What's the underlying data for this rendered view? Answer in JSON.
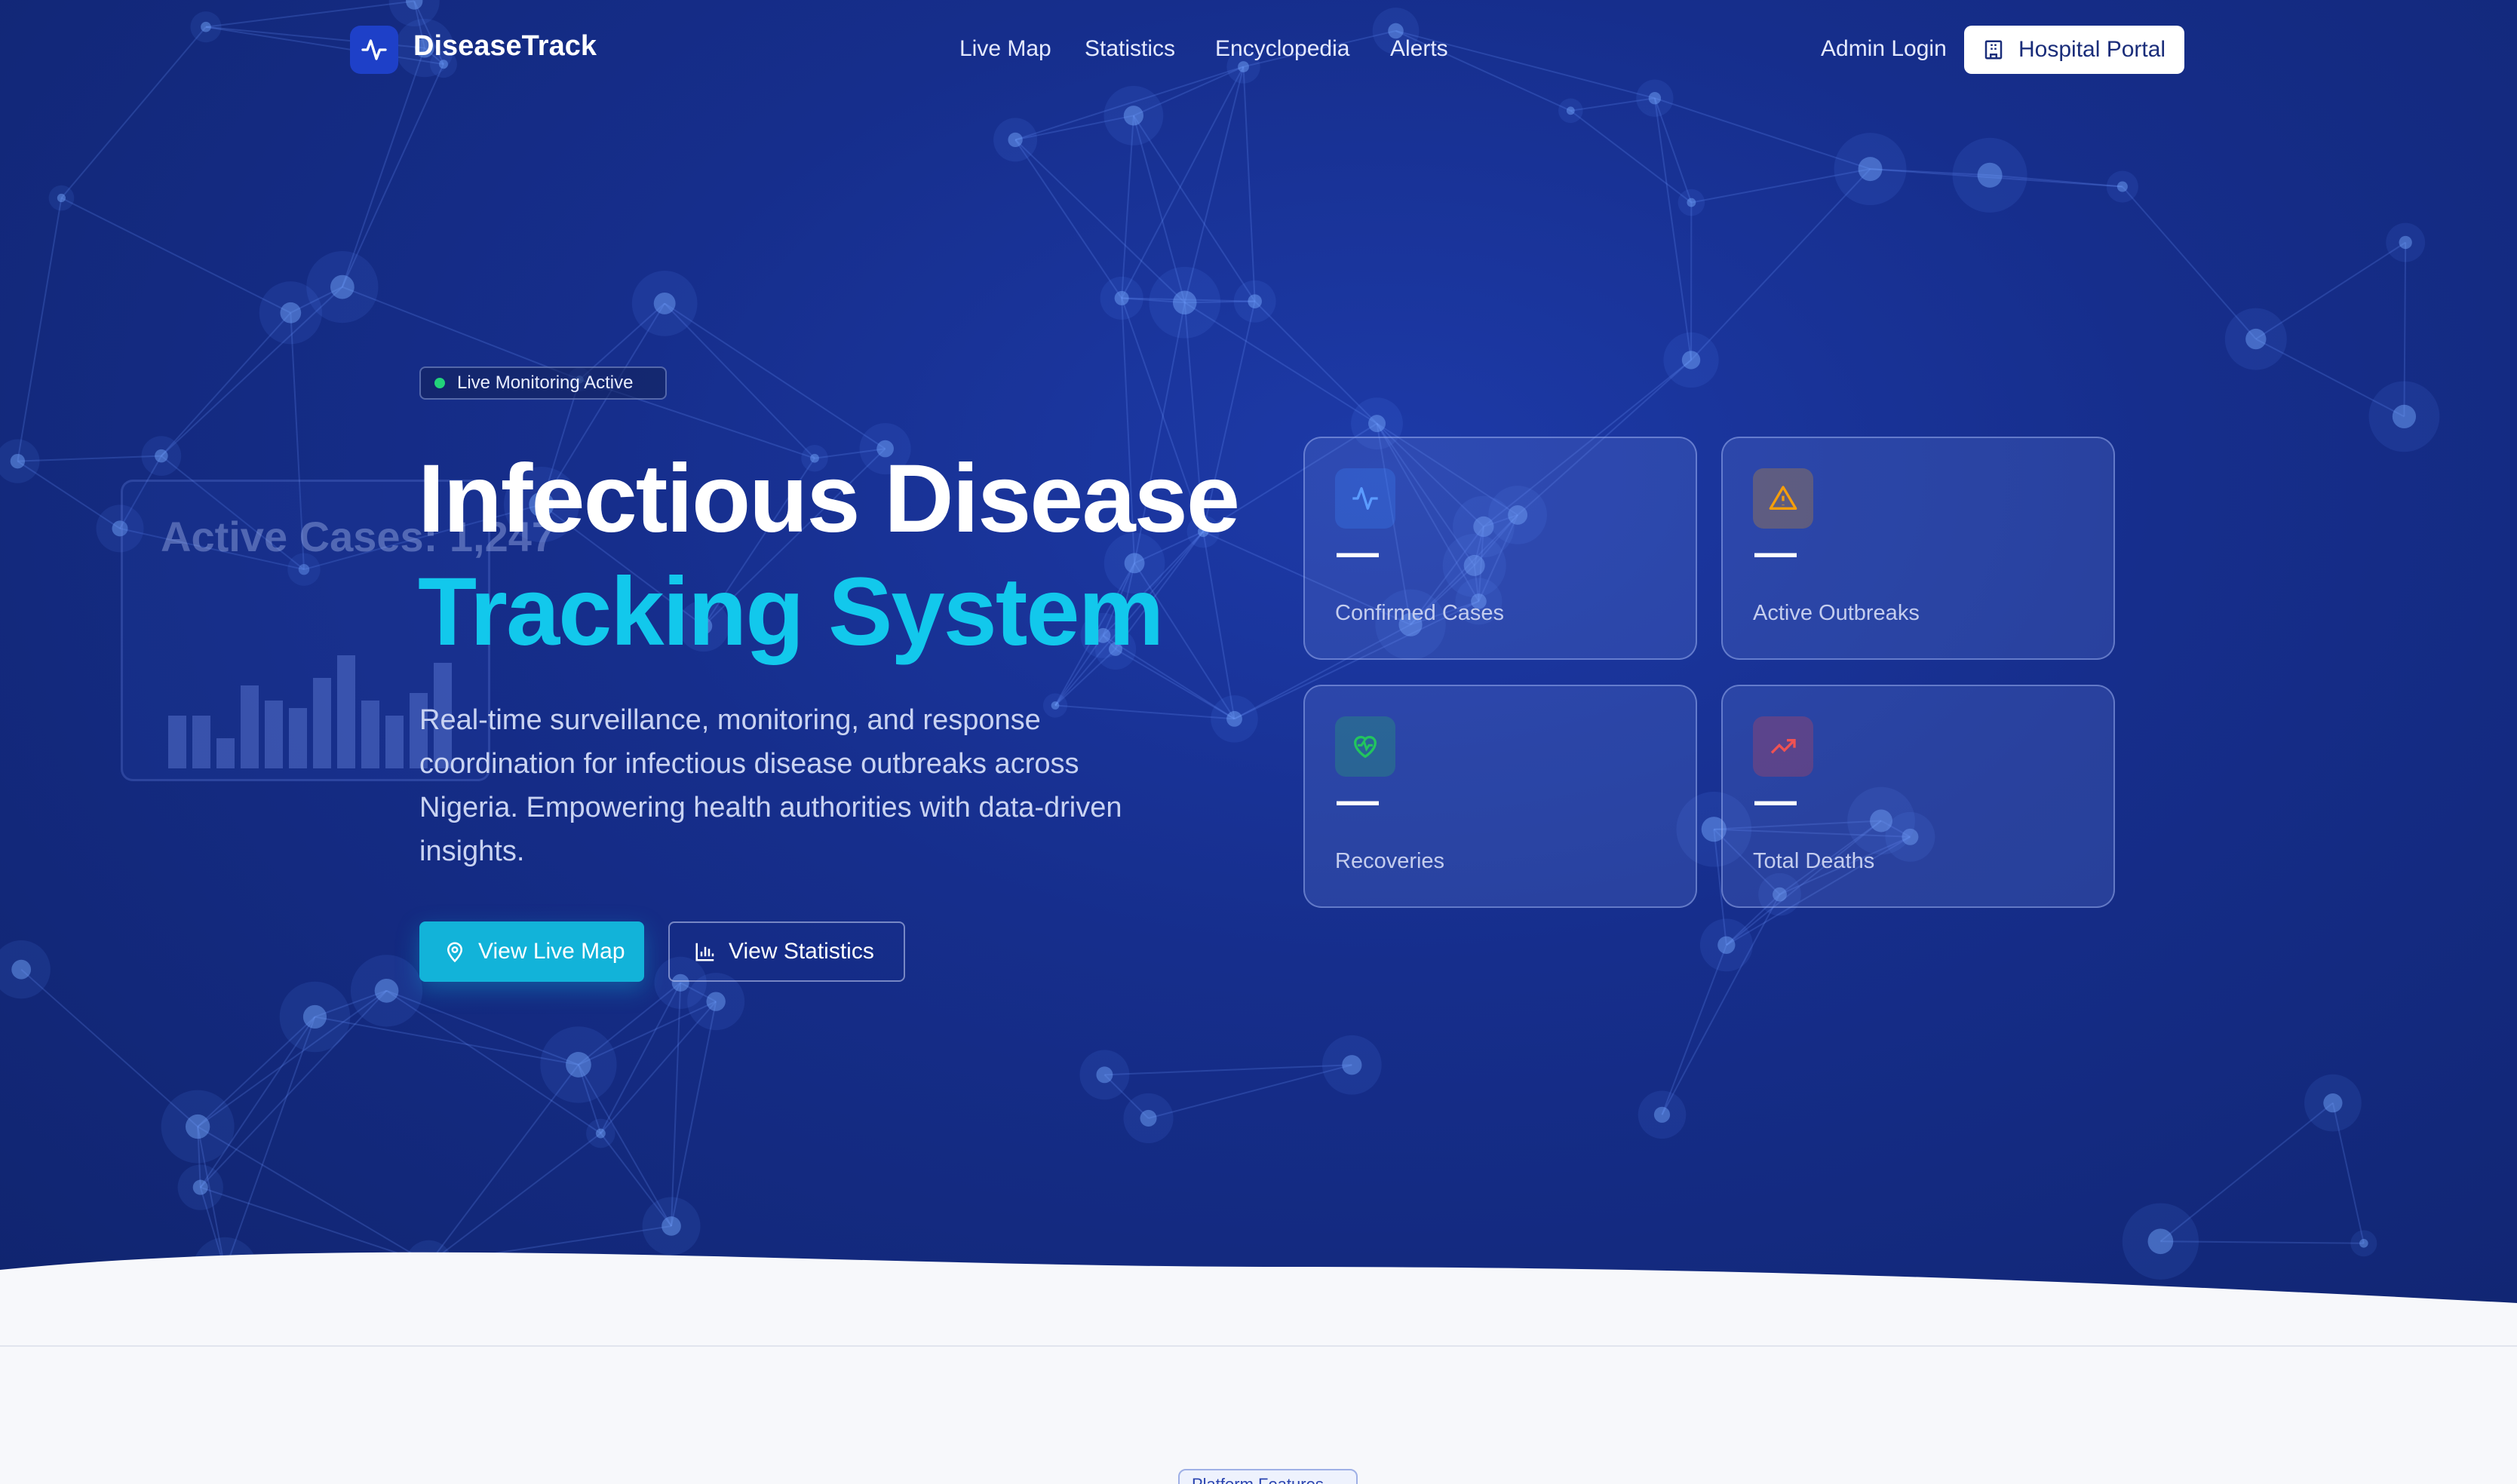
{
  "nav": {
    "brand": "DiseaseTrack",
    "links": [
      "Live Map",
      "Statistics",
      "Encyclopedia",
      "Alerts"
    ],
    "admin_login": "Admin Login",
    "hospital_portal": "Hospital Portal"
  },
  "hero": {
    "badge": "Live Monitoring Active",
    "title_line1": "Infectious Disease",
    "title_line2": "Tracking System",
    "description": "Real-time surveillance, monitoring, and response coordination for infectious disease outbreaks across Nigeria. Empowering health authorities with data-driven insights.",
    "primary_button": "View Live Map",
    "secondary_button": "View Statistics",
    "background_card_text": "Active Cases: 1,247"
  },
  "stats": [
    {
      "label": "Confirmed Cases",
      "value": "—",
      "icon": "activity-icon",
      "color": "#3b82f6"
    },
    {
      "label": "Active Outbreaks",
      "value": "—",
      "icon": "warning-triangle-icon",
      "color": "#f59e0b"
    },
    {
      "label": "Recoveries",
      "value": "—",
      "icon": "heart-pulse-icon",
      "color": "#22c55e"
    },
    {
      "label": "Total Deaths",
      "value": "—",
      "icon": "trending-up-icon",
      "color": "#ef4444"
    }
  ],
  "next_section": {
    "badge": "Platform Features"
  },
  "colors": {
    "accent": "#12b3d9",
    "title_highlight": "#12c8ec",
    "hero_bg": "#162e8c",
    "live_dot": "#22d37a"
  }
}
